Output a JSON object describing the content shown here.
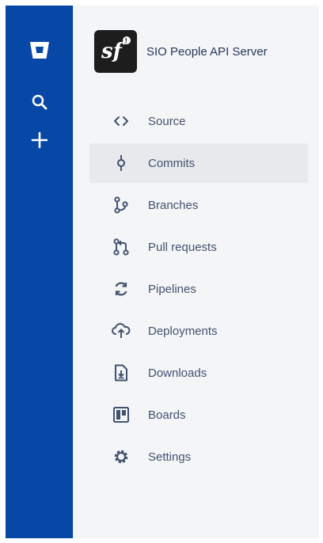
{
  "colors": {
    "global_nav_bg": "#0747a6",
    "sidebar_bg": "#f4f5f7",
    "active_item_bg": "#e7e9ed",
    "text": "#42526e"
  },
  "global_nav": {
    "items": [
      {
        "icon": "bitbucket-logo-icon"
      },
      {
        "icon": "search-icon"
      },
      {
        "icon": "plus-icon"
      }
    ]
  },
  "repo": {
    "name": "SIO People API Server",
    "avatar_icon": "symfony-logo-icon"
  },
  "menu": {
    "active": "Commits",
    "items": [
      {
        "label": "Source",
        "icon": "code-icon"
      },
      {
        "label": "Commits",
        "icon": "commit-icon"
      },
      {
        "label": "Branches",
        "icon": "branch-icon"
      },
      {
        "label": "Pull requests",
        "icon": "pull-request-icon"
      },
      {
        "label": "Pipelines",
        "icon": "pipelines-icon"
      },
      {
        "label": "Deployments",
        "icon": "cloud-upload-icon"
      },
      {
        "label": "Downloads",
        "icon": "download-file-icon"
      },
      {
        "label": "Boards",
        "icon": "board-icon"
      },
      {
        "label": "Settings",
        "icon": "gear-icon"
      }
    ]
  }
}
